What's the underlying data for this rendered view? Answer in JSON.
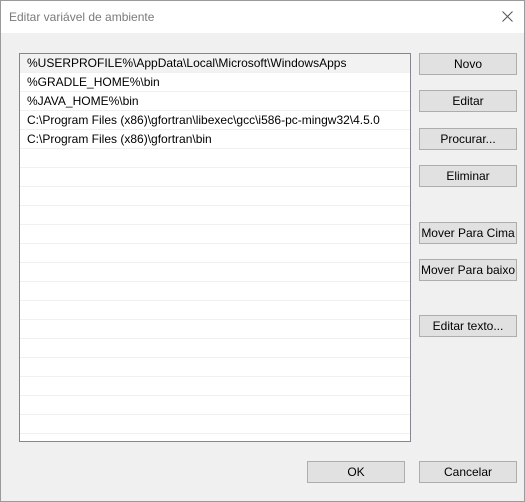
{
  "window": {
    "title": "Editar variável de ambiente"
  },
  "list": {
    "items": [
      "%USERPROFILE%\\AppData\\Local\\Microsoft\\WindowsApps",
      "%GRADLE_HOME%\\bin",
      "%JAVA_HOME%\\bin",
      "C:\\Program Files (x86)\\gfortran\\libexec\\gcc\\i586-pc-mingw32\\4.5.0",
      "C:\\Program Files (x86)\\gfortran\\bin",
      "",
      "",
      "",
      "",
      "",
      "",
      "",
      "",
      "",
      "",
      "",
      "",
      "",
      "",
      ""
    ],
    "selected_index": 0
  },
  "buttons": {
    "novo": "Novo",
    "editar": "Editar",
    "procurar": "Procurar...",
    "eliminar": "Eliminar",
    "mover_cima": "Mover Para Cima",
    "mover_baixo": "Mover Para baixo",
    "editar_texto": "Editar texto...",
    "ok": "OK",
    "cancelar": "Cancelar"
  },
  "icons": {
    "close": "close-icon"
  }
}
